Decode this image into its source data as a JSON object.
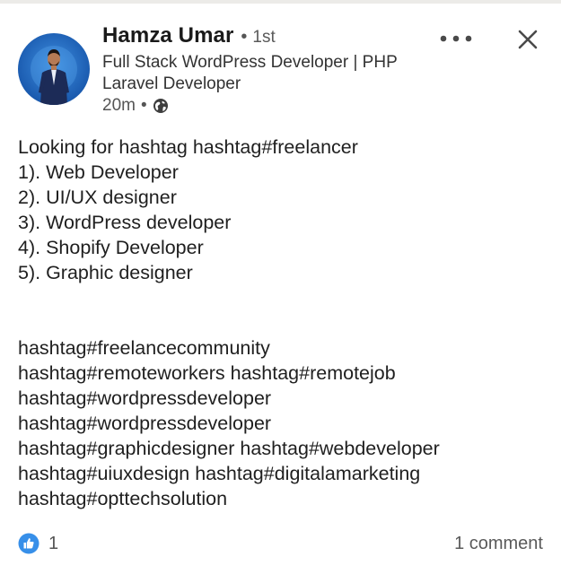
{
  "author": {
    "name": "Hamza Umar",
    "connection": "1st",
    "headline": "Full Stack WordPress Developer | PHP Laravel Developer",
    "time": "20m",
    "visibility_icon": "globe-icon"
  },
  "header_actions": {
    "more_icon": "more-options-icon",
    "close_icon": "close-icon"
  },
  "post": {
    "lines": [
      "Looking for hashtag hashtag#freelancer",
      "1). Web Developer",
      "2). UI/UX designer",
      "3). WordPress developer",
      "4). Shopify Developer",
      "5). Graphic designer"
    ],
    "hashtag_lines": [
      "hashtag#freelancecommunity",
      "hashtag#remoteworkers hashtag#remotejob",
      "hashtag#wordpressdeveloper",
      "hashtag#wordpressdeveloper",
      "hashtag#graphicdesigner hashtag#webdeveloper",
      "hashtag#uiuxdesign hashtag#digitalamarketing",
      "hashtag#opttechsolution"
    ]
  },
  "social": {
    "reaction_icon": "like-icon",
    "reaction_count": "1",
    "comments": "1 comment"
  },
  "colors": {
    "like_blue": "#378fe9",
    "text": "#1f1f1f",
    "muted": "#5a5a5a"
  }
}
